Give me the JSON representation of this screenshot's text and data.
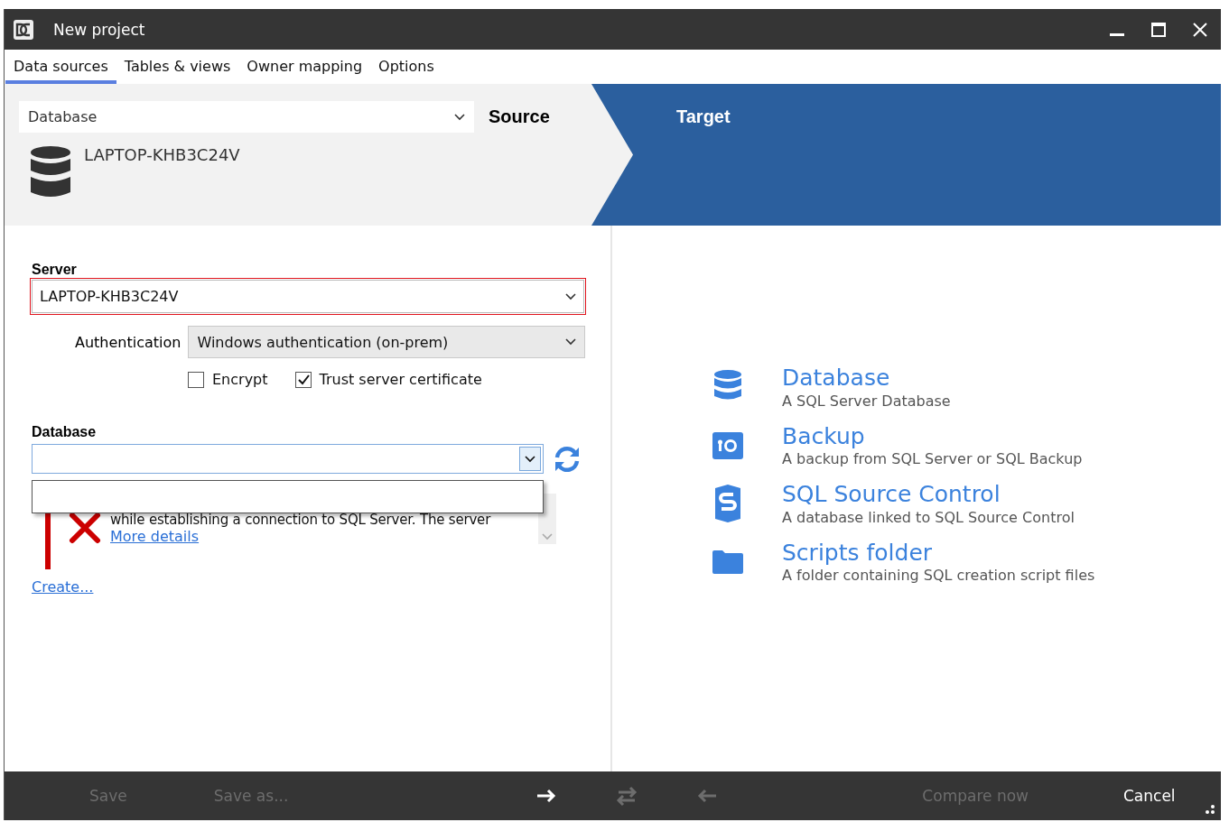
{
  "window": {
    "title": "New project"
  },
  "tabs": [
    {
      "label": "Data sources",
      "selected": true
    },
    {
      "label": "Tables & views",
      "selected": false
    },
    {
      "label": "Owner mapping",
      "selected": false
    },
    {
      "label": "Options",
      "selected": false
    }
  ],
  "source": {
    "type_dropdown": "Database",
    "heading": "Source",
    "server_name": "LAPTOP-KHB3C24V"
  },
  "target": {
    "heading": "Target",
    "options": [
      {
        "kind": "database",
        "title": "Database",
        "description": "A SQL Server Database"
      },
      {
        "kind": "backup",
        "title": "Backup",
        "description": "A backup from SQL Server or SQL Backup"
      },
      {
        "kind": "source_control",
        "title": "SQL Source Control",
        "description": "A database linked to SQL Source Control"
      },
      {
        "kind": "folder",
        "title": "Scripts folder",
        "description": "A folder containing SQL creation script files"
      }
    ]
  },
  "server": {
    "label": "Server",
    "value": "LAPTOP-KHB3C24V",
    "invalid": true
  },
  "authentication": {
    "label": "Authentication",
    "value": "Windows authentication (on-prem)"
  },
  "checkboxes": [
    {
      "label": "Encrypt",
      "checked": false
    },
    {
      "label": "Trust server certificate",
      "checked": true
    }
  ],
  "database": {
    "label": "Database",
    "expanded": true
  },
  "error": {
    "message": "while establishing a connection to SQL Server. The server",
    "link": "More details"
  },
  "create_link": "Create...",
  "footer": {
    "left_buttons": [
      {
        "label": "Save",
        "disabled": true
      },
      {
        "label": "Save as...",
        "disabled": true
      }
    ],
    "arrows": [
      {
        "kind": "right",
        "disabled": false
      },
      {
        "kind": "swap",
        "disabled": true
      },
      {
        "kind": "left",
        "disabled": true
      }
    ],
    "right_buttons": [
      {
        "label": "Compare now",
        "disabled": true
      },
      {
        "label": "Cancel",
        "disabled": false
      }
    ]
  }
}
